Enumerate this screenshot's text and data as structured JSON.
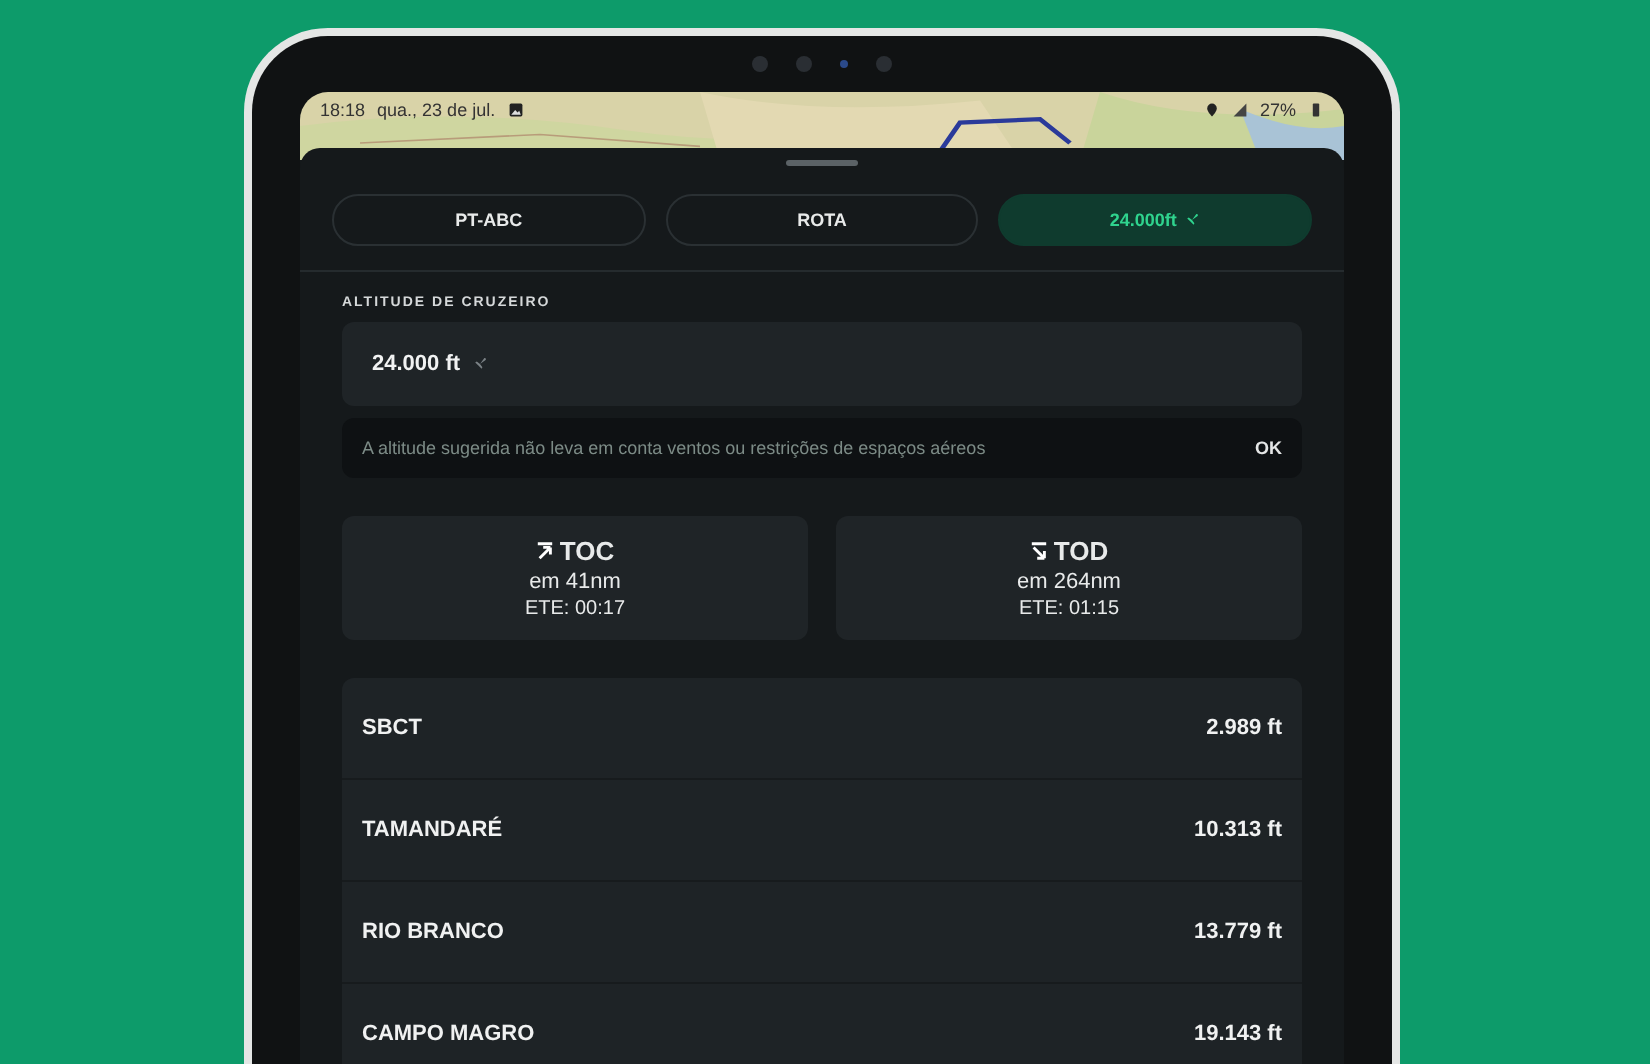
{
  "status_bar": {
    "time": "18:18",
    "date": "qua., 23 de jul.",
    "battery": "27%"
  },
  "tabs": [
    {
      "label": "PT-ABC",
      "selected": false,
      "kind": "text"
    },
    {
      "label": "ROTA",
      "selected": false,
      "kind": "text"
    },
    {
      "label": "24.000ft",
      "selected": true,
      "kind": "altitude"
    }
  ],
  "cruise_altitude": {
    "label": "ALTITUDE DE CRUZEIRO",
    "value": "24.000 ft",
    "notice": "A altitude sugerida não leva em conta ventos ou restrições de espaços aéreos",
    "notice_action": "OK"
  },
  "climb_descent": [
    {
      "kind": "toc",
      "label": "TOC",
      "distance": "em 41nm",
      "ete": "ETE: 00:17"
    },
    {
      "kind": "tod",
      "label": "TOD",
      "distance": "em 264nm",
      "ete": "ETE: 01:15"
    }
  ],
  "waypoints": [
    {
      "name": "SBCT",
      "elevation": "2.989 ft"
    },
    {
      "name": "TAMANDARÉ",
      "elevation": "10.313 ft"
    },
    {
      "name": "RIO BRANCO",
      "elevation": "13.779 ft"
    },
    {
      "name": "CAMPO MAGRO",
      "elevation": "19.143 ft"
    }
  ]
}
